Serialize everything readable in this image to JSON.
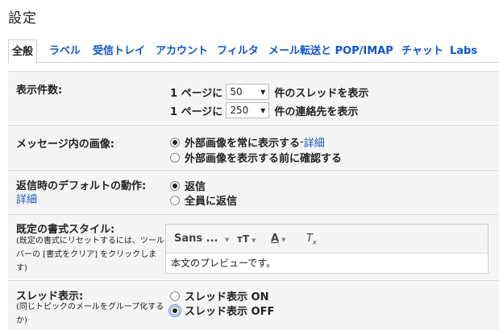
{
  "page_title": "設定",
  "tabs": [
    {
      "label": "全般"
    },
    {
      "label": "ラベル"
    },
    {
      "label": "受信トレイ"
    },
    {
      "label": "アカウント"
    },
    {
      "label": "フィルタ"
    },
    {
      "label": "メール転送と POP/IMAP"
    },
    {
      "label": "チャット"
    },
    {
      "label": "Labs"
    }
  ],
  "max_page_size": {
    "label": "表示件数:",
    "row1": {
      "prefix": "1 ページに",
      "value": "50",
      "suffix": "件のスレッドを表示"
    },
    "row2": {
      "prefix": "1 ページに",
      "value": "250",
      "suffix": "件の連絡先を表示"
    }
  },
  "images": {
    "label": "メッセージ内の画像:",
    "option1": "外部画像を常に表示する",
    "option1_sep": " - ",
    "option1_link": "詳細",
    "option2": "外部画像を表示する前に確認する"
  },
  "reply": {
    "label": "返信時のデフォルトの動作:",
    "link": "詳細",
    "option1": "返信",
    "option2": "全員に返信"
  },
  "text_style": {
    "label": "既定の書式スタイル:",
    "note": "(既定の書式にリセットするには、ツールバーの [書式をクリア] をクリックします)",
    "font": "Sans ...",
    "preview": "本文のプレビューです。"
  },
  "conversation": {
    "label": "スレッド表示:",
    "note": "(同じトピックのメールをグループ化するか)",
    "option1": "スレッド表示 ON",
    "option2": "スレッド表示 OFF"
  },
  "colors": {
    "link": "#1155cc",
    "section_bg": "#f5f5f5"
  }
}
